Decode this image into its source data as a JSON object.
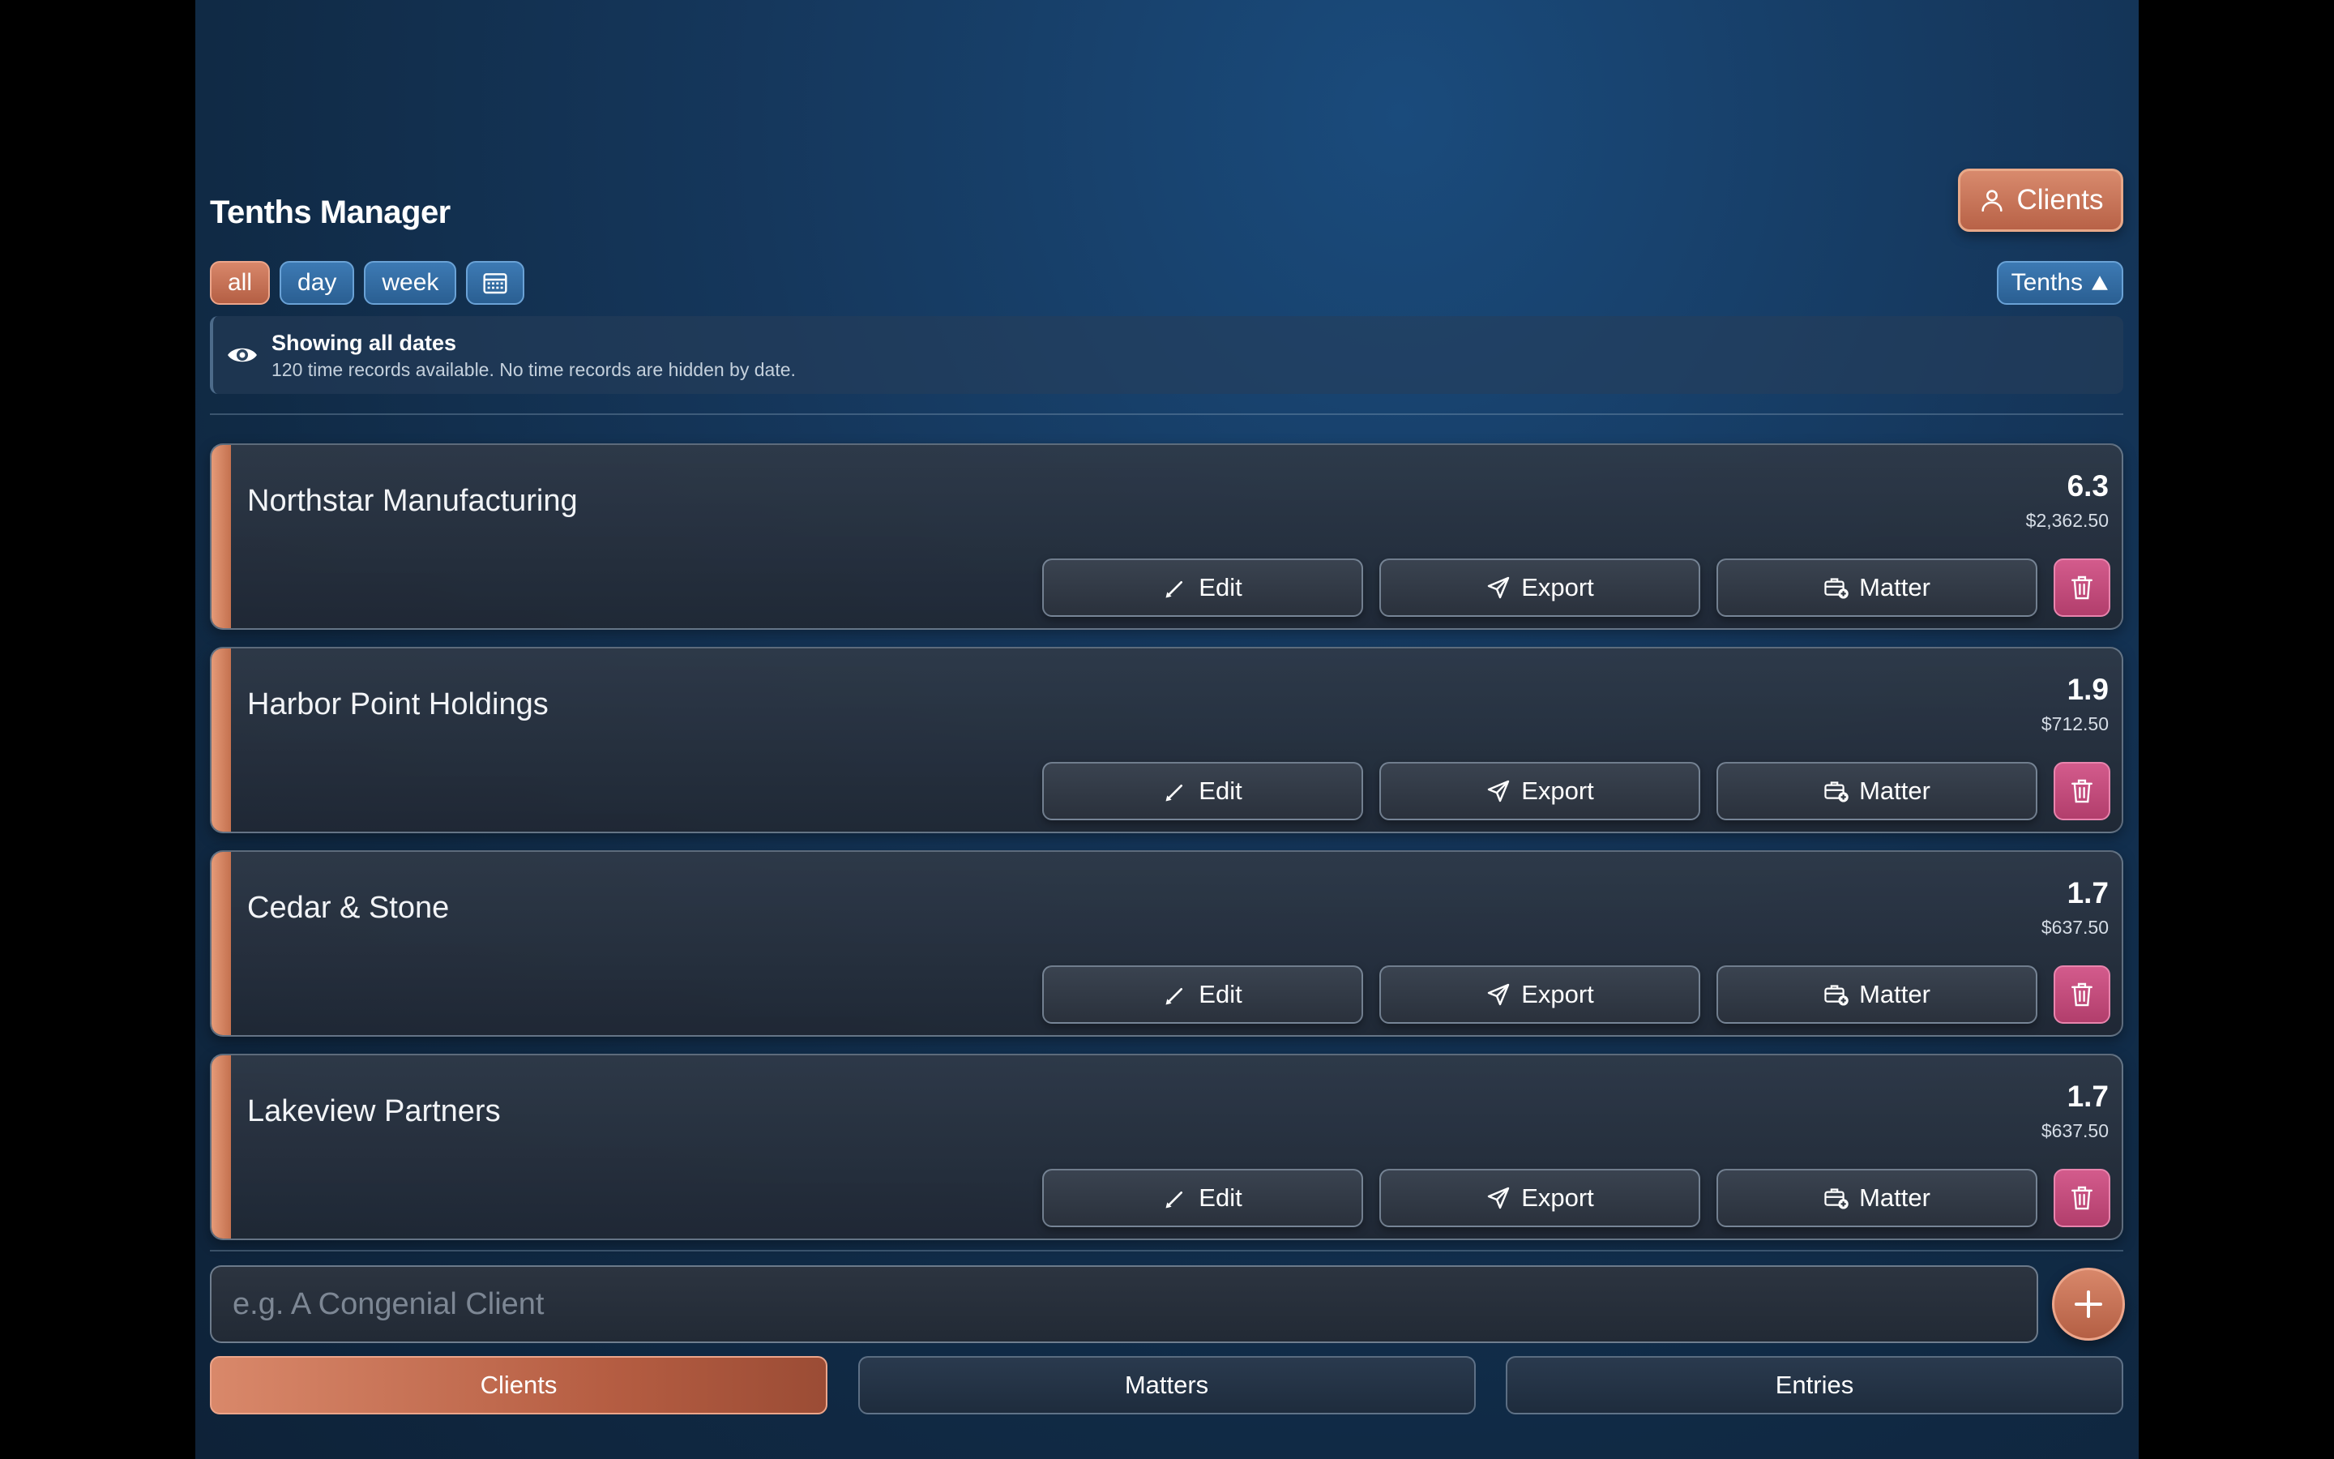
{
  "header": {
    "title": "Tenths Manager",
    "clients_button": "Clients",
    "sort_button": "Tenths"
  },
  "filters": [
    {
      "label": "all",
      "active": true
    },
    {
      "label": "day",
      "active": false
    },
    {
      "label": "week",
      "active": false
    }
  ],
  "filter_calendar_icon": "calendar-icon",
  "banner": {
    "icon": "eye-icon",
    "title": "Showing all dates",
    "subtitle": "120 time records available. No time records are hidden by date."
  },
  "actions": {
    "edit": "Edit",
    "export": "Export",
    "matter": "Matter"
  },
  "clients": [
    {
      "name": "Northstar Manufacturing",
      "tenths": "6.3",
      "amount": "$2,362.50"
    },
    {
      "name": "Harbor Point Holdings",
      "tenths": "1.9",
      "amount": "$712.50"
    },
    {
      "name": "Cedar & Stone",
      "tenths": "1.7",
      "amount": "$637.50"
    },
    {
      "name": "Lakeview Partners",
      "tenths": "1.7",
      "amount": "$637.50"
    }
  ],
  "new_client": {
    "placeholder": "e.g. A Congenial Client"
  },
  "tabs": [
    {
      "label": "Clients",
      "active": true
    },
    {
      "label": "Matters",
      "active": false
    },
    {
      "label": "Entries",
      "active": false
    }
  ],
  "colors": {
    "accent": "#c86e50",
    "delete": "#c24a7a",
    "filter_blue": "#3a75ad",
    "background": "#133559"
  }
}
